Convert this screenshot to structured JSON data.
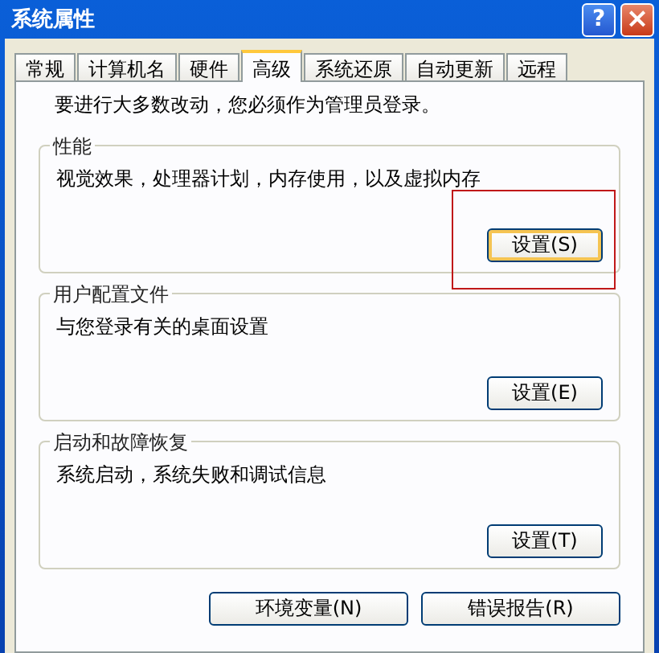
{
  "window": {
    "title": "系统属性",
    "title_buttons": [
      {
        "kind": "help",
        "label": "?"
      },
      {
        "kind": "close",
        "label": "×"
      }
    ]
  },
  "tabs": [
    {
      "label": "常规",
      "selected": false
    },
    {
      "label": "计算机名",
      "selected": false
    },
    {
      "label": "硬件",
      "selected": false
    },
    {
      "label": "高级",
      "selected": true
    },
    {
      "label": "系统还原",
      "selected": false
    },
    {
      "label": "自动更新",
      "selected": false
    },
    {
      "label": "远程",
      "selected": false
    }
  ],
  "notice": "要进行大多数改动，您必须作为管理员登录。",
  "groups": [
    {
      "title": "性能",
      "description": "视觉效果，处理器计划，内存使用，以及虚拟内存",
      "button": "设置(S)",
      "highlighted": true
    },
    {
      "title": "用户配置文件",
      "description": "与您登录有关的桌面设置",
      "button": "设置(E)",
      "highlighted": false
    },
    {
      "title": "启动和故障恢复",
      "description": "系统启动，系统失败和调试信息",
      "button": "设置(T)",
      "highlighted": false
    }
  ],
  "buttons": [
    "环境变量(N)",
    "错误报告(R)"
  ]
}
